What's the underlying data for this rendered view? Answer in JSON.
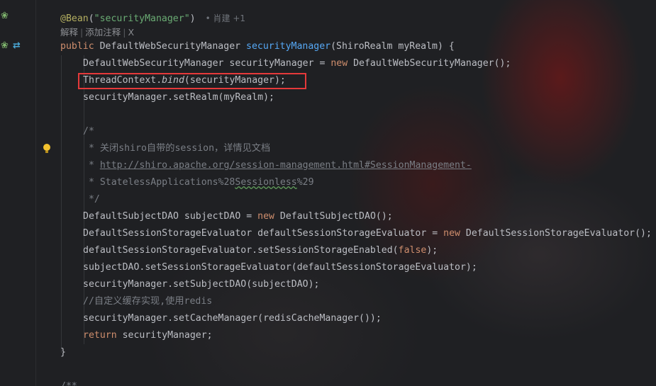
{
  "colors": {
    "background": "#1f2023",
    "keyword": "#cf8e6d",
    "annotation": "#b3ae60",
    "string": "#6aab73",
    "method_name": "#56a8f5",
    "comment": "#7a7e85",
    "default_text": "#bcbec4",
    "highlight_box": "#e5393a"
  },
  "gutter": {
    "icons": [
      "bean-icon",
      "bean-icon",
      "implements-icon",
      "lightbulb-icon"
    ]
  },
  "hints": {
    "author_icon": "•",
    "author": "肖建 +1",
    "explain": "解释",
    "add_comment": "添加注释",
    "close": "X",
    "separator": "|"
  },
  "code": {
    "l1_annotation": "@Bean",
    "l1_paren_open": "(",
    "l1_string": "\"securityManager\"",
    "l1_paren_close": ")",
    "l2_public": "public",
    "l2_type": " DefaultWebSecurityManager ",
    "l2_method": "securityManager",
    "l2_params": "(ShiroRealm myRealm) {",
    "l3_decl": "DefaultWebSecurityManager securityManager = ",
    "l3_new": "new",
    "l3_rest": " DefaultWebSecurityManager();",
    "l4_class": "ThreadContext.",
    "l4_method": "bind",
    "l4_rest": "(securityManager);",
    "l5": "securityManager.setRealm(myRealm);",
    "c1": "/*",
    "c2": " * 关闭shiro自带的session，详情见文档",
    "c3_prefix": " * ",
    "c3_link": "http://shiro.apache.org/session-management.html#SessionManagement-",
    "c4_prefix": " * StatelessApplications%28",
    "c4_wavy": "Sessionless",
    "c4_suffix": "%29",
    "c5": " */",
    "l6_decl": "DefaultSubjectDAO subjectDAO = ",
    "l6_new": "new",
    "l6_rest": " DefaultSubjectDAO();",
    "l7_decl": "DefaultSessionStorageEvaluator defaultSessionStorageEvaluator = ",
    "l7_new": "new",
    "l7_rest": " DefaultSessionStorageEvaluator();",
    "l8_pre": "defaultSessionStorageEvaluator.setSessionStorageEnabled(",
    "l8_false": "false",
    "l8_post": ");",
    "l9": "subjectDAO.setSessionStorageEvaluator(defaultSessionStorageEvaluator);",
    "l10": "securityManager.setSubjectDAO(subjectDAO);",
    "l11_comment": "//自定义缓存实现,使用redis",
    "l12": "securityManager.setCacheManager(redisCacheManager());",
    "l13_return": "return",
    "l13_rest": " securityManager;",
    "l14": "}",
    "l15": "/**"
  }
}
